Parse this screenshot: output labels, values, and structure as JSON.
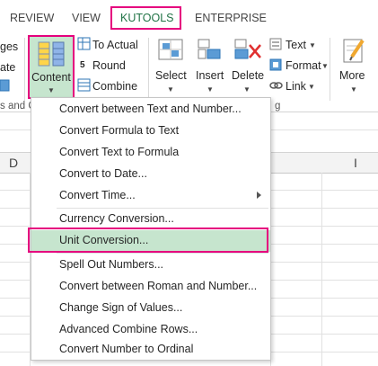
{
  "tabs": [
    "REVIEW",
    "VIEW",
    "KUTOOLS",
    "ENTERPRISE"
  ],
  "ribbon": {
    "left_partial_top": "ges",
    "left_partial_mid": "ate",
    "group_label_left": "s and C",
    "group_label_mid": "g",
    "content_label": "Content",
    "to_actual": "To Actual",
    "round": "Round",
    "combine": "Combine",
    "select": "Select",
    "insert": "Insert",
    "delete": "Delete",
    "text": "Text",
    "format": "Format",
    "link": "Link",
    "more": "More",
    "small_num": "5"
  },
  "columns": [
    "D",
    "I"
  ],
  "menu": {
    "items": [
      "Convert between Text and Number...",
      "Convert Formula to Text",
      "Convert Text to Formula",
      "Convert to Date...",
      "Convert Time...",
      "Currency Conversion...",
      "Unit Conversion...",
      "Spell Out Numbers...",
      "Convert between Roman and Number...",
      "Change Sign of Values...",
      "Advanced Combine Rows...",
      "Convert Number to Ordinal"
    ]
  },
  "colors": {
    "highlight_border": "#e5007e",
    "selected_fill": "#c6e5ce",
    "accent": "#217346"
  }
}
